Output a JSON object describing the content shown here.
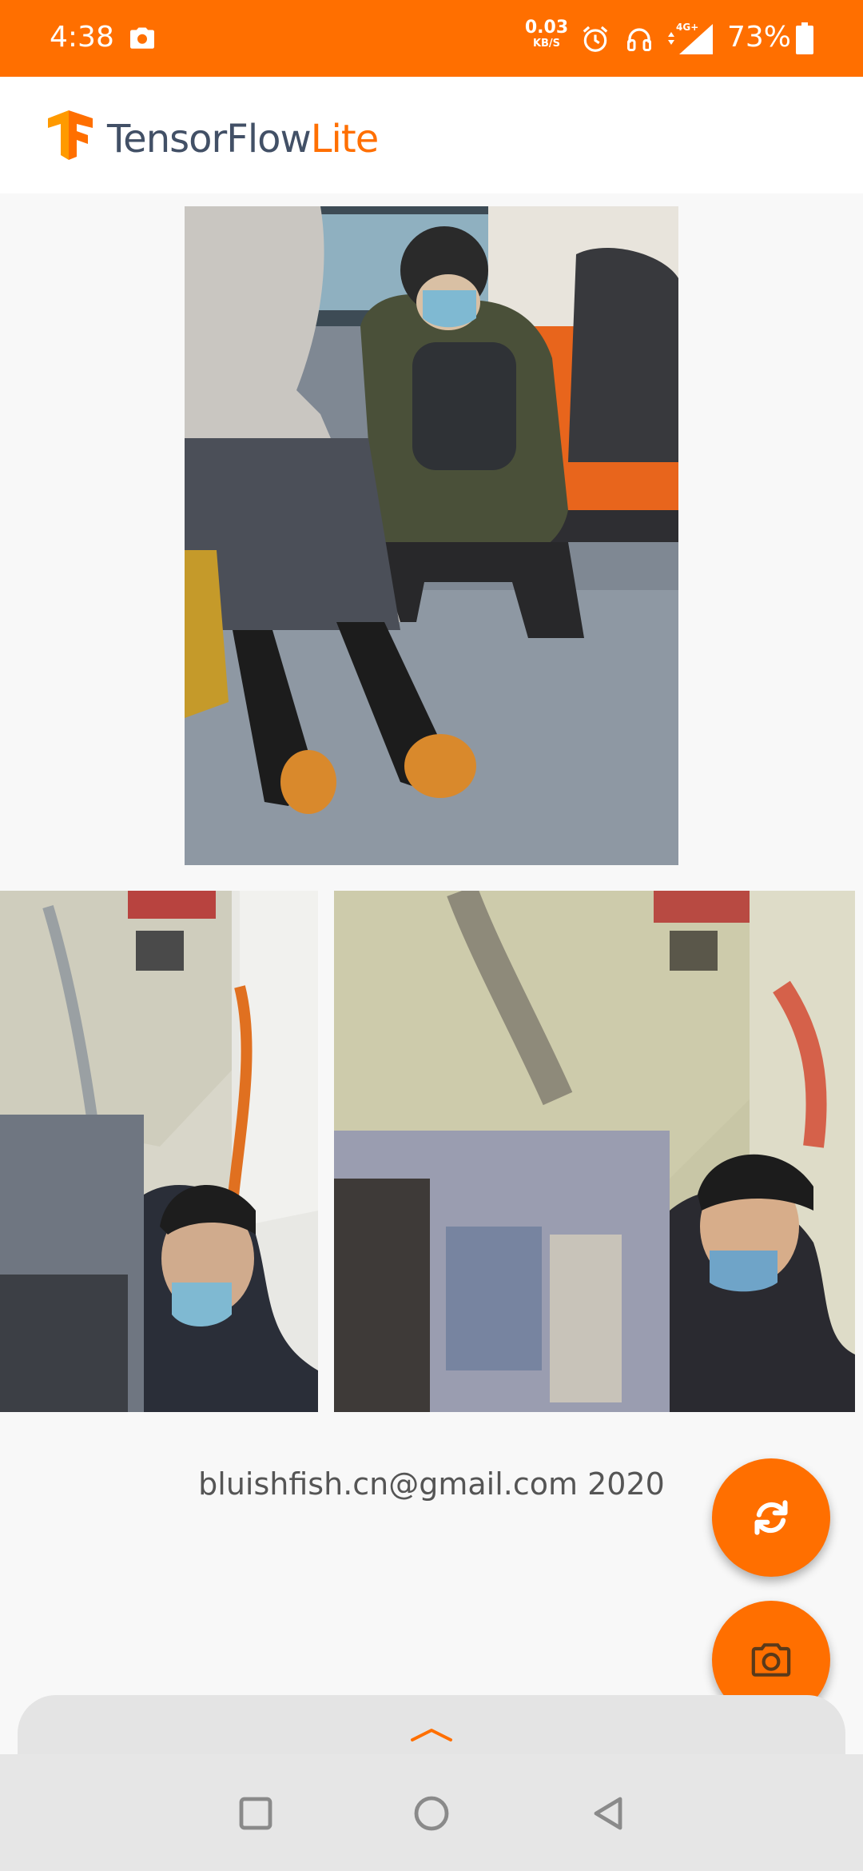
{
  "status_bar": {
    "time": "4:38",
    "net_speed_value": "0.03",
    "net_speed_unit": "KB/S",
    "network_type": "4G+",
    "battery_percent": "73%",
    "icons": [
      "camera-icon",
      "alarm-icon",
      "headset-icon",
      "signal-icon",
      "battery-icon"
    ]
  },
  "app_bar": {
    "logo_main": "TensorFlow",
    "logo_accent": "Lite"
  },
  "images": {
    "content": "content-image",
    "style": "style-image",
    "stylized": "stylized-image"
  },
  "footer": {
    "credit": "bluishfish.cn@gmail.com 2020"
  },
  "fabs": {
    "switch_icon": "refresh-icon",
    "capture_icon": "camera-icon"
  },
  "nav_bar": {
    "buttons": [
      "recents-icon",
      "home-icon",
      "back-icon"
    ]
  },
  "colors": {
    "accent": "#ff6f00",
    "logo_text": "#425066",
    "background": "#f8f8f8",
    "nav_bar": "#e6e6e6",
    "footer_text": "#555555"
  }
}
